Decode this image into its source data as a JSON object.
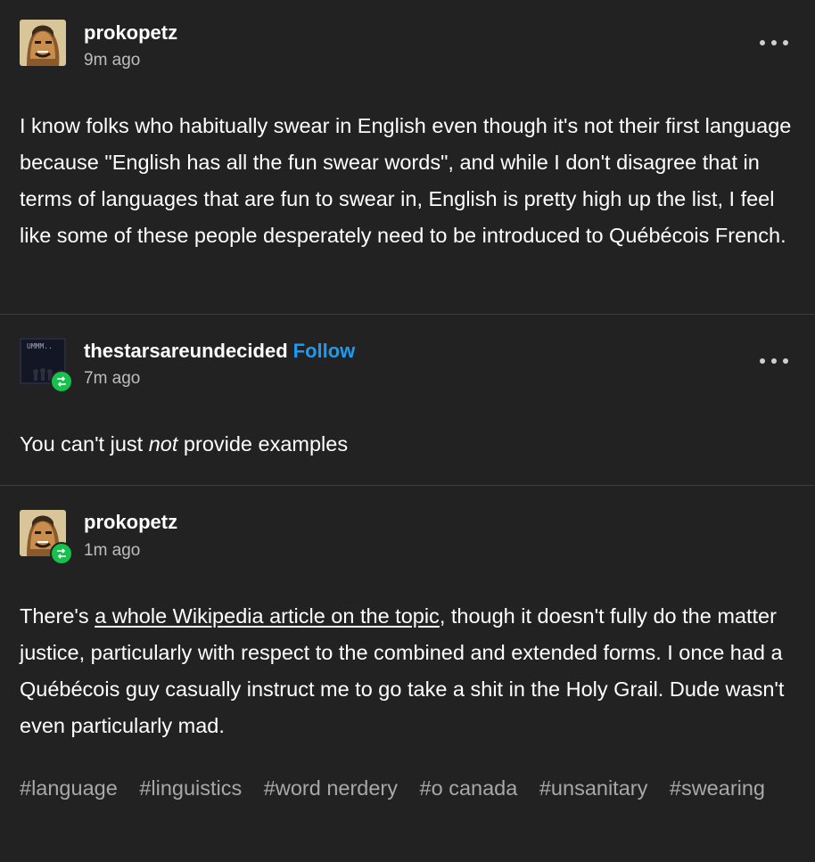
{
  "posts": [
    {
      "username": "prokopetz",
      "time": "9m ago",
      "body": "I know folks who habitually swear in English even though it's not their first language because \"English has all the fun swear words\", and while I don't disagree that in terms of languages that are fun to swear in, English is pretty high up the list, I feel like some of these people desperately need to be introduced to Québécois French."
    },
    {
      "username": "thestarsareundecided",
      "follow_label": "Follow",
      "time": "7m ago",
      "avatar_text": "UMMM..",
      "body_before": "You can't just ",
      "body_em": "not",
      "body_after": " provide examples"
    },
    {
      "username": "prokopetz",
      "time": "1m ago",
      "body_before": "There's ",
      "body_link": "a whole Wikipedia article on the topic",
      "body_after": ", though it doesn't fully do the matter justice, particularly with respect to the combined and extended forms. I once had a Québécois guy casually instruct me to go take a shit in the Holy Grail. Dude wasn't even particularly mad."
    }
  ],
  "tags": [
    "#language",
    "#linguistics",
    "#word nerdery",
    "#o canada",
    "#unsanitary",
    "#swearing"
  ],
  "colors": {
    "background": "#222222",
    "follow": "#1d9bf0",
    "reblog_badge": "#16c24d",
    "tag": "#a8a8a8"
  }
}
